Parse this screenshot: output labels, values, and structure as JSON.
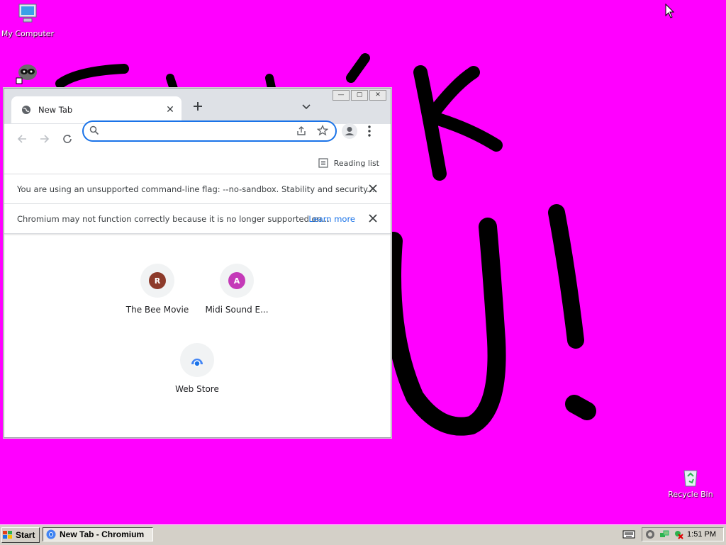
{
  "desktop": {
    "background": "#ff00ff",
    "icons": [
      {
        "label": "My Computer",
        "icon": "my-computer-icon"
      },
      {
        "label": "",
        "icon": "raccoon-shortcut-icon"
      },
      {
        "label": "Recycle Bin",
        "icon": "recycle-bin-icon"
      }
    ]
  },
  "browser": {
    "tab": {
      "title": "New Tab",
      "icon": "globe-icon"
    },
    "new_tab_icon": "plus-icon",
    "tab_search_icon": "chevron-down-icon",
    "omnibox": {
      "value": "",
      "placeholder": ""
    },
    "bookmarks_bar": {
      "reading_list_label": "Reading list"
    },
    "infobars": [
      {
        "message": "You are using an unsupported command-line flag: --no-sandbox. Stability and security...",
        "link": ""
      },
      {
        "message": "Chromium may not function correctly because it is no longer supported on...",
        "link": "Learn more"
      }
    ],
    "shortcuts": [
      {
        "label": "The Bee Movie",
        "letter": "R",
        "color": "#8d3b2b"
      },
      {
        "label": "Midi Sound E...",
        "letter": "A",
        "color": "#c43ab8"
      },
      {
        "label": "Web Store",
        "letter": "",
        "color": "#4285f4"
      }
    ]
  },
  "taskbar": {
    "start_label": "Start",
    "task_label": "New Tab - Chromium",
    "clock": "1:51 PM"
  },
  "colors": {
    "accent": "#1a73e8",
    "taskbar": "#d4d0c8"
  }
}
